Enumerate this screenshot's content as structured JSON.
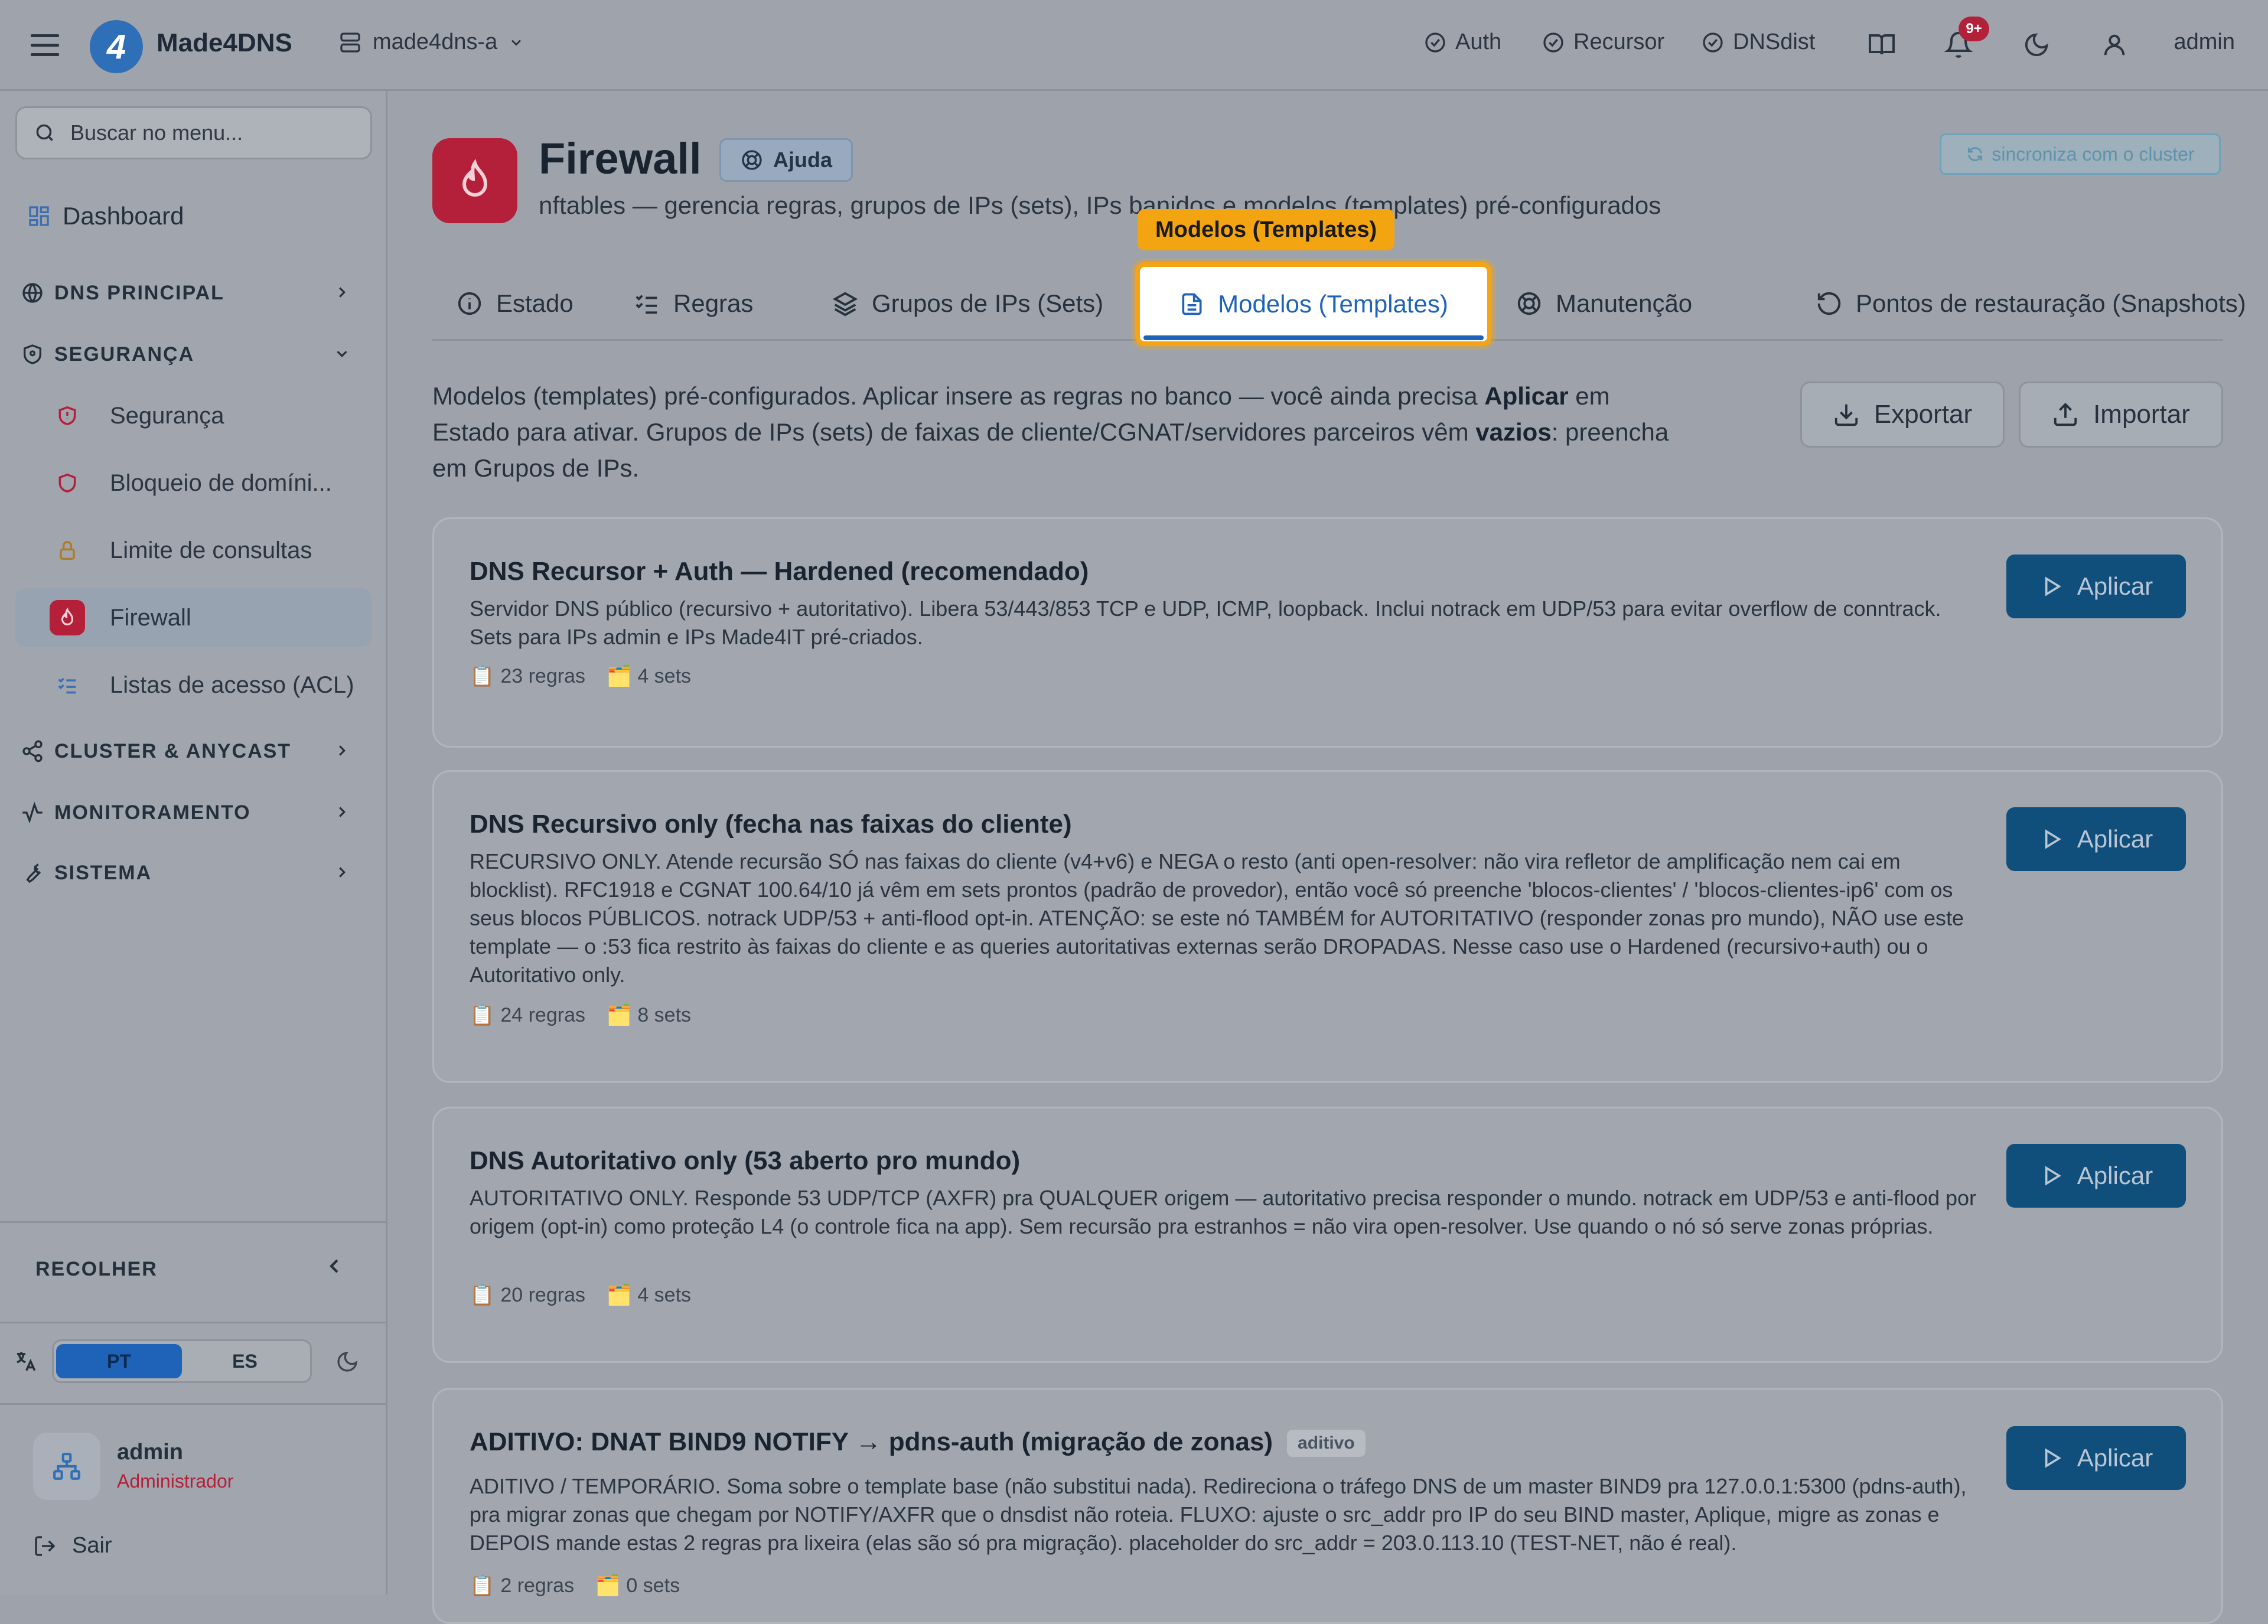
{
  "topbar": {
    "brand": "Made4DNS",
    "logo_letter": "4",
    "server": "made4dns-a",
    "services": [
      "Auth",
      "Recursor",
      "DNSdist"
    ],
    "notifications_badge": "9+",
    "user": "admin"
  },
  "sidebar": {
    "search_placeholder": "Buscar no menu...",
    "dashboard": "Dashboard",
    "sections": {
      "dns": "DNS PRINCIPAL",
      "security": "SEGURANÇA",
      "cluster": "CLUSTER & ANYCAST",
      "monitoring": "MONITORAMENTO",
      "system": "SISTEMA"
    },
    "security_items": [
      "Segurança",
      "Bloqueio de domíni...",
      "Limite de consultas",
      "Firewall",
      "Listas de acesso (ACL)"
    ],
    "collapse_label": "RECOLHER",
    "languages": [
      "PT",
      "ES"
    ],
    "user_name": "admin",
    "user_role": "Administrador",
    "logout": "Sair"
  },
  "page": {
    "title": "Firewall",
    "help": "Ajuda",
    "subtitle": "nftables — gerencia regras, grupos de IPs (sets), IPs banidos e modelos (templates) pré-configurados",
    "sync": "sincroniza com o cluster",
    "tooltip": "Modelos (Templates)",
    "tabs": [
      "Estado",
      "Regras",
      "Grupos de IPs (Sets)",
      "Modelos (Templates)",
      "Manutenção",
      "Pontos de restauração (Snapshots)"
    ],
    "active_tab": "Modelos (Templates)",
    "desc": {
      "p1": "Modelos (templates) pré-configurados. Aplicar insere as regras no banco — você ainda precisa ",
      "b1": "Aplicar",
      "p2": " em Estado para ativar. Grupos de IPs (sets) de faixas de cliente/CGNAT/servidores parceiros vêm ",
      "b2": "vazios",
      "p3": ": preencha em Grupos de IPs."
    },
    "export": "Exportar",
    "import": "Importar",
    "apply_label": "Aplicar"
  },
  "templates": [
    {
      "title": "DNS Recursor + Auth — Hardened (recomendado)",
      "tag": "",
      "description": "Servidor DNS público (recursivo + autoritativo). Libera 53/443/853 TCP e UDP, ICMP, loopback. Inclui notrack em UDP/53 para evitar overflow de conntrack. Sets para IPs admin e IPs Made4IT pré-criados.",
      "rules": "23 regras",
      "sets": "4 sets"
    },
    {
      "title": "DNS Recursivo only (fecha nas faixas do cliente)",
      "tag": "",
      "description": "RECURSIVO ONLY. Atende recursão SÓ nas faixas do cliente (v4+v6) e NEGA o resto (anti open-resolver: não vira refletor de amplificação nem cai em blocklist). RFC1918 e CGNAT 100.64/10 já vêm em sets prontos (padrão de provedor), então você só preenche 'blocos-clientes' / 'blocos-clientes-ip6' com os seus blocos PÚBLICOS. notrack UDP/53 + anti-flood opt-in. ATENÇÃO: se este nó TAMBÉM for AUTORITATIVO (responder zonas pro mundo), NÃO use este template — o :53 fica restrito às faixas do cliente e as queries autoritativas externas serão DROPADAS. Nesse caso use o Hardened (recursivo+auth) ou o Autoritativo only.",
      "rules": "24 regras",
      "sets": "8 sets"
    },
    {
      "title": "DNS Autoritativo only (53 aberto pro mundo)",
      "tag": "",
      "description": "AUTORITATIVO ONLY. Responde 53 UDP/TCP (AXFR) pra QUALQUER origem — autoritativo precisa responder o mundo. notrack em UDP/53 e anti-flood por origem (opt-in) como proteção L4 (o controle fica na app). Sem recursão pra estranhos = não vira open-resolver. Use quando o nó só serve zonas próprias.",
      "rules": "20 regras",
      "sets": "4 sets"
    },
    {
      "title": "ADITIVO: DNAT BIND9 NOTIFY → pdns-auth (migração de zonas)",
      "tag": "aditivo",
      "description": "ADITIVO / TEMPORÁRIO. Soma sobre o template base (não substitui nada). Redireciona o tráfego DNS de um master BIND9 pra 127.0.0.1:5300 (pdns-auth), pra migrar zonas que chegam por NOTIFY/AXFR que o dnsdist não roteia. FLUXO: ajuste o src_addr pro IP do seu BIND master, Aplique, migre as zonas e DEPOIS mande estas 2 regras pra lixeira (elas são só pra migração). placeholder do src_addr = 203.0.113.10 (TEST-NET, não é real).",
      "rules": "2 regras",
      "sets": "0 sets"
    }
  ]
}
